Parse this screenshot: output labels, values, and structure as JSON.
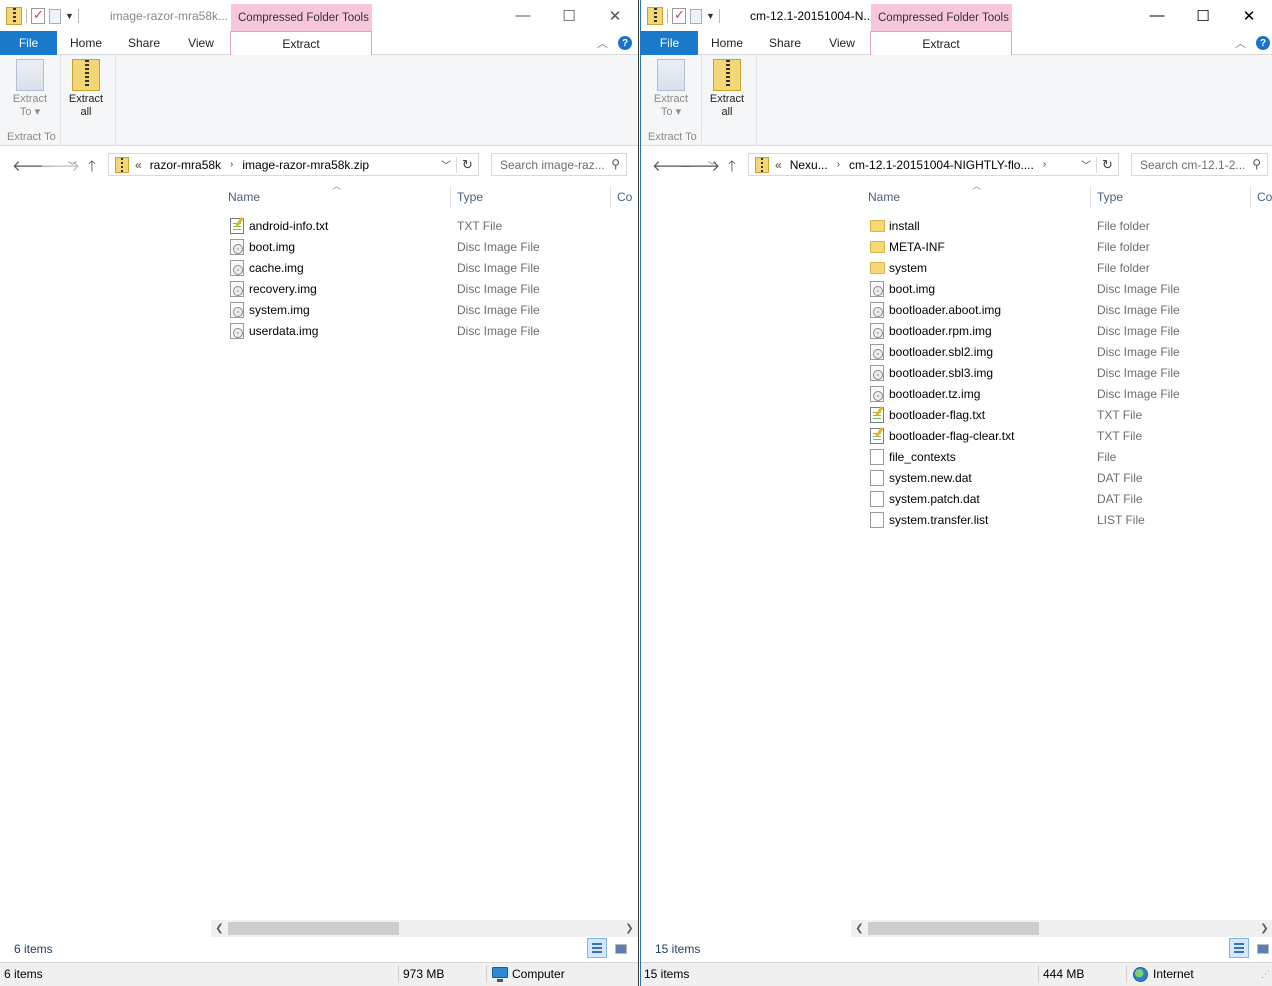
{
  "windows": {
    "left": {
      "title": "image-razor-mra58k...",
      "context_tab": "Compressed Folder Tools",
      "tabs": {
        "file": "File",
        "home": "Home",
        "share": "Share",
        "view": "View",
        "extract": "Extract"
      },
      "ribbon": {
        "extract_to": "Extract",
        "extract_to_2": "To",
        "extract_all": "Extract",
        "extract_all_2": "all",
        "group_label": "Extract To"
      },
      "address": {
        "prefix": "«",
        "crumbs": [
          "razor-mra58k",
          "image-razor-mra58k.zip"
        ]
      },
      "search_placeholder": "Search image-raz...",
      "columns": {
        "name": "Name",
        "type": "Type",
        "extra": "Co"
      },
      "files": [
        {
          "name": "android-info.txt",
          "type": "TXT File",
          "icon": "text-file-icon"
        },
        {
          "name": "boot.img",
          "type": "Disc Image File",
          "icon": "disc-image-icon"
        },
        {
          "name": "cache.img",
          "type": "Disc Image File",
          "icon": "disc-image-icon"
        },
        {
          "name": "recovery.img",
          "type": "Disc Image File",
          "icon": "disc-image-icon"
        },
        {
          "name": "system.img",
          "type": "Disc Image File",
          "icon": "disc-image-icon"
        },
        {
          "name": "userdata.img",
          "type": "Disc Image File",
          "icon": "disc-image-icon"
        }
      ],
      "item_count": "6 items",
      "statusbar": {
        "items": "6 items",
        "size": "973 MB",
        "zone": "Computer"
      }
    },
    "right": {
      "title": "cm-12.1-20151004-N...",
      "context_tab": "Compressed Folder Tools",
      "tabs": {
        "file": "File",
        "home": "Home",
        "share": "Share",
        "view": "View",
        "extract": "Extract"
      },
      "ribbon": {
        "extract_to": "Extract",
        "extract_to_2": "To",
        "extract_all": "Extract",
        "extract_all_2": "all",
        "group_label": "Extract To"
      },
      "address": {
        "prefix": "«",
        "crumbs": [
          "Nexu...",
          "cm-12.1-20151004-NIGHTLY-flo...."
        ]
      },
      "search_placeholder": "Search cm-12.1-2...",
      "columns": {
        "name": "Name",
        "type": "Type",
        "extra": "Co"
      },
      "files": [
        {
          "name": "install",
          "type": "File folder",
          "icon": "folder-icon"
        },
        {
          "name": "META-INF",
          "type": "File folder",
          "icon": "folder-icon"
        },
        {
          "name": "system",
          "type": "File folder",
          "icon": "folder-icon"
        },
        {
          "name": "boot.img",
          "type": "Disc Image File",
          "icon": "disc-image-icon"
        },
        {
          "name": "bootloader.aboot.img",
          "type": "Disc Image File",
          "icon": "disc-image-icon"
        },
        {
          "name": "bootloader.rpm.img",
          "type": "Disc Image File",
          "icon": "disc-image-icon"
        },
        {
          "name": "bootloader.sbl2.img",
          "type": "Disc Image File",
          "icon": "disc-image-icon"
        },
        {
          "name": "bootloader.sbl3.img",
          "type": "Disc Image File",
          "icon": "disc-image-icon"
        },
        {
          "name": "bootloader.tz.img",
          "type": "Disc Image File",
          "icon": "disc-image-icon"
        },
        {
          "name": "bootloader-flag.txt",
          "type": "TXT File",
          "icon": "text-file-icon"
        },
        {
          "name": "bootloader-flag-clear.txt",
          "type": "TXT File",
          "icon": "text-file-icon"
        },
        {
          "name": "file_contexts",
          "type": "File",
          "icon": "blank-file-icon"
        },
        {
          "name": "system.new.dat",
          "type": "DAT File",
          "icon": "blank-file-icon"
        },
        {
          "name": "system.patch.dat",
          "type": "DAT File",
          "icon": "blank-file-icon"
        },
        {
          "name": "system.transfer.list",
          "type": "LIST File",
          "icon": "blank-file-icon"
        }
      ],
      "item_count": "15 items",
      "statusbar": {
        "items": "15 items",
        "size": "444 MB",
        "zone": "Internet"
      }
    }
  }
}
